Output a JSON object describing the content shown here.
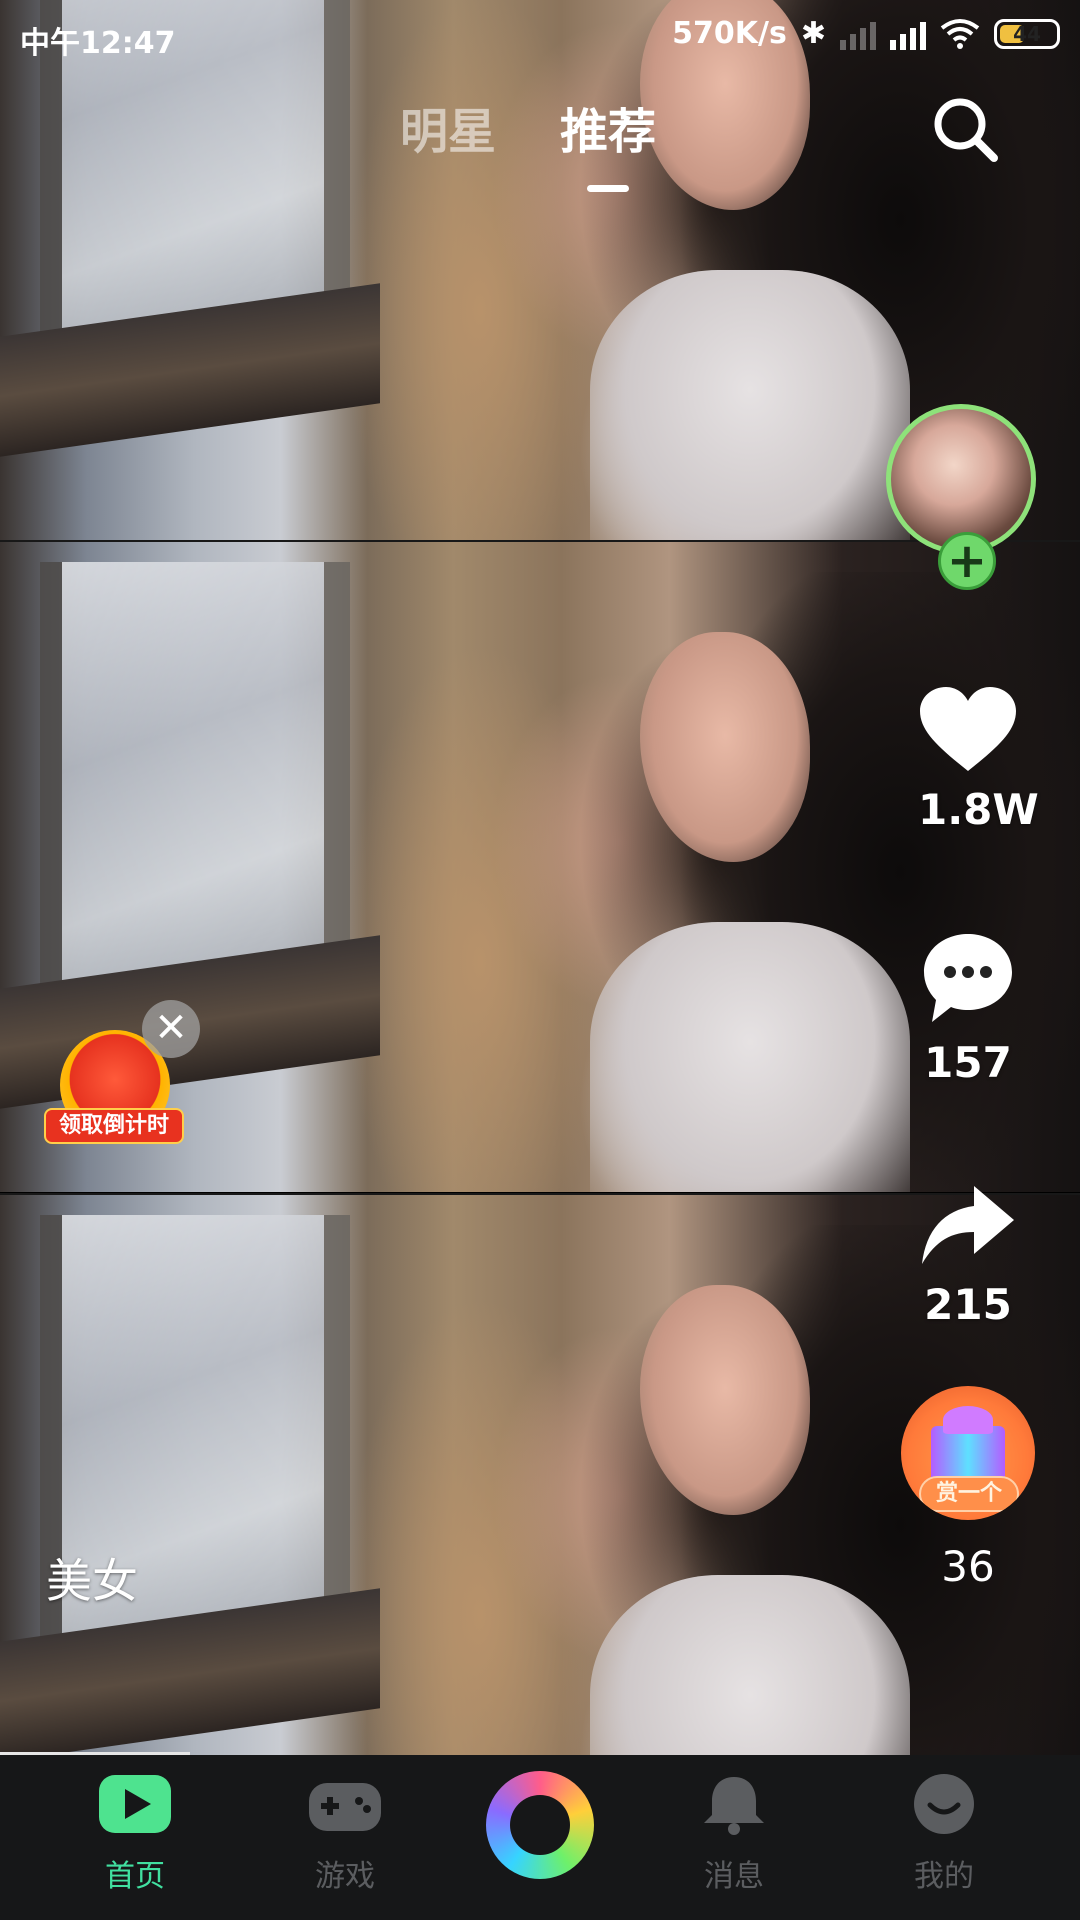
{
  "status_bar": {
    "time": "中午12:47",
    "network_speed": "570K/s",
    "battery": "44"
  },
  "top_tabs": [
    {
      "label": "明星",
      "active": false
    },
    {
      "label": "推荐",
      "active": true
    }
  ],
  "actions": {
    "likes": "1.8W",
    "comments": "157",
    "shares": "215",
    "gifts": "36",
    "gift_tag": "赏一个"
  },
  "packet": {
    "label": "领取倒计时"
  },
  "caption": "美女",
  "bottom_nav": [
    {
      "label": "首页",
      "active": true
    },
    {
      "label": "游戏",
      "active": false
    },
    {
      "label": "消息",
      "active": false
    },
    {
      "label": "我的",
      "active": false
    }
  ],
  "colors": {
    "nav_active": "#41e0a0",
    "nav_inactive": "#5b5d60",
    "follow_green": "#6fd86b",
    "packet_red": "#e8321f"
  },
  "icons": [
    "bluetooth-icon",
    "signal-icon",
    "wifi-icon",
    "battery-icon",
    "search-icon",
    "heart-icon",
    "comment-icon",
    "share-icon",
    "gift-icon",
    "close-icon",
    "play-icon",
    "gamepad-icon",
    "bell-icon",
    "face-icon"
  ]
}
